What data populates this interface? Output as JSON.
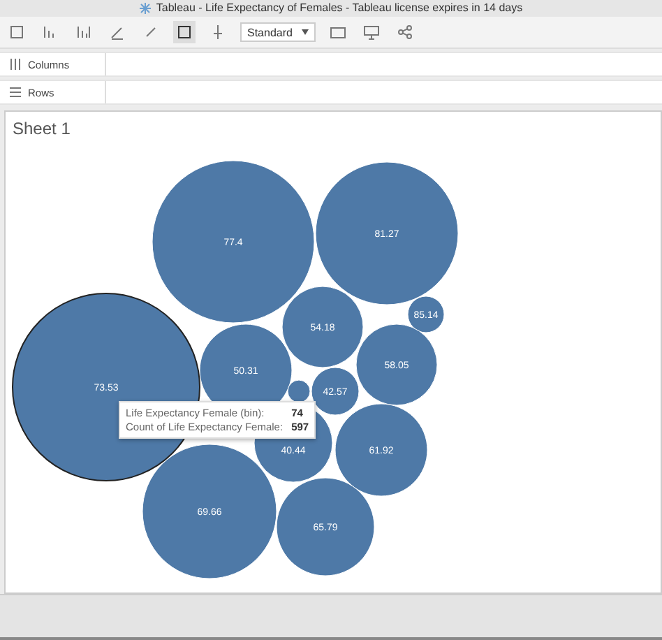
{
  "window": {
    "title": "Tableau - Life Expectancy of Females - Tableau license expires in 14 days"
  },
  "toolbar": {
    "mark_size": "Standard"
  },
  "shelves": [
    {
      "kind": "columns",
      "label": "Columns"
    },
    {
      "kind": "rows",
      "label": "Rows"
    }
  ],
  "sheet": {
    "title": "Sheet 1",
    "bubbles": [
      {
        "label": "77.4",
        "selected": false
      },
      {
        "label": "81.27",
        "selected": false
      },
      {
        "label": "54.18",
        "selected": false
      },
      {
        "label": "85.14",
        "selected": false
      },
      {
        "label": "50.31",
        "selected": false
      },
      {
        "label": "58.05",
        "selected": false
      },
      {
        "label": "73.53",
        "selected": true
      },
      {
        "selected": false
      },
      {
        "label": "42.57",
        "selected": false
      },
      {
        "label": "40.44",
        "selected": false
      },
      {
        "label": "61.92",
        "selected": false
      },
      {
        "label": "69.66",
        "selected": false
      },
      {
        "label": "65.79",
        "selected": false
      }
    ],
    "tooltip": [
      {
        "label": "Life Expectancy Female (bin):",
        "value": "74"
      },
      {
        "label": "Count of Life Expectancy Female:",
        "value": "597"
      }
    ]
  }
}
